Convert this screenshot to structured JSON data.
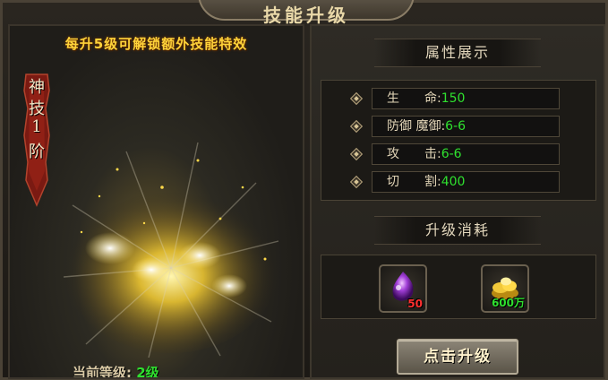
{
  "window": {
    "title": "技能升级"
  },
  "left": {
    "headline": "每升5级可解锁额外技能特效",
    "badge": [
      "神",
      "技",
      "1",
      "阶"
    ],
    "level_label": "当前等级:",
    "level_value": "2级"
  },
  "attributes": {
    "title": "属性展示",
    "rows": [
      {
        "label": "生　　命:",
        "value": "150"
      },
      {
        "label": "防御 魔御:",
        "value": "6-6"
      },
      {
        "label": "攻　　击:",
        "value": "6-6"
      },
      {
        "label": "切　　割:",
        "value": "400"
      }
    ]
  },
  "cost": {
    "title": "升级消耗",
    "items": [
      {
        "icon": "purple-gem-icon",
        "count": "50",
        "count_color": "#ff3030"
      },
      {
        "icon": "gold-ingot-icon",
        "count": "600万",
        "count_color": "#2fe02f"
      }
    ]
  },
  "upgrade_button": "点击升级",
  "colors": {
    "accent_yellow": "#ffd33a",
    "value_green": "#2fe02f",
    "panel_border": "#4a4335"
  }
}
